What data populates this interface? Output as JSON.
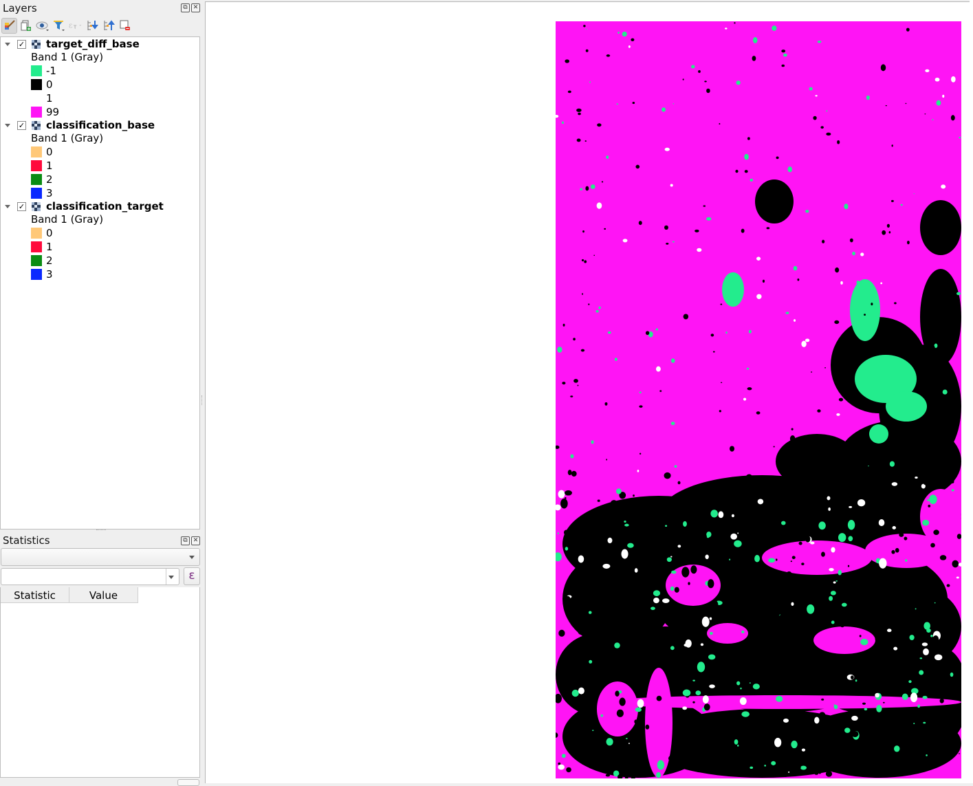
{
  "layers_panel": {
    "title": "Layers",
    "toolbar": [
      {
        "icon": "style-manager-icon",
        "state": "active"
      },
      {
        "icon": "add-group-icon",
        "state": "normal"
      },
      {
        "icon": "visibility-eye-icon",
        "state": "normal"
      },
      {
        "icon": "filter-legend-icon",
        "state": "normal"
      },
      {
        "icon": "filter-expression-icon",
        "state": "disabled"
      },
      {
        "icon": "expand-all-icon",
        "state": "normal"
      },
      {
        "icon": "collapse-all-icon",
        "state": "normal"
      },
      {
        "icon": "remove-layer-icon",
        "state": "normal"
      }
    ],
    "layers": [
      {
        "name": "target_diff_base",
        "checked": true,
        "band": "Band 1 (Gray)",
        "classes": [
          {
            "label": "-1",
            "color": "#23ec8d"
          },
          {
            "label": "0",
            "color": "#000000"
          },
          {
            "label": "1",
            "color": "#ffffff"
          },
          {
            "label": "99",
            "color": "#ff14f5"
          }
        ]
      },
      {
        "name": "classification_base",
        "checked": true,
        "band": "Band 1 (Gray)",
        "classes": [
          {
            "label": "0",
            "color": "#ffc878"
          },
          {
            "label": "1",
            "color": "#ff0a3c"
          },
          {
            "label": "2",
            "color": "#0a8c14"
          },
          {
            "label": "3",
            "color": "#0a28ff"
          }
        ]
      },
      {
        "name": "classification_target",
        "checked": true,
        "band": "Band 1 (Gray)",
        "classes": [
          {
            "label": "0",
            "color": "#ffc878"
          },
          {
            "label": "1",
            "color": "#ff0a3c"
          },
          {
            "label": "2",
            "color": "#0a8c14"
          },
          {
            "label": "3",
            "color": "#0a28ff"
          }
        ]
      }
    ]
  },
  "statistics_panel": {
    "title": "Statistics",
    "layer_combo_value": "",
    "field_combo_value": "",
    "expression_button_label": "ε",
    "columns": [
      "Statistic",
      "Value"
    ],
    "rows": []
  },
  "map": {
    "layer_shown": "target_diff_base",
    "colors": {
      "changed_neg": "#23ec8d",
      "unchanged": "#000000",
      "changed_pos": "#ffffff",
      "nodata": "#ff14f5"
    }
  }
}
